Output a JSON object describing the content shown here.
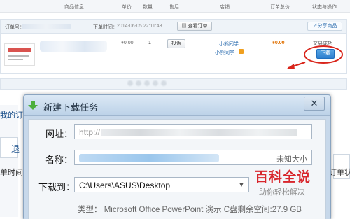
{
  "table_header": {
    "columns": [
      "商品信息",
      "单价",
      "数量",
      "售后",
      "店铺",
      "订单总价",
      "状态与操作"
    ]
  },
  "order": {
    "order_no_label": "订单号：",
    "order_time_label": "下单时间：",
    "order_time": "2014-06-05 22:11:43",
    "view_order_label": "查看订单",
    "share_label": "分享商品",
    "unit_price": "¥0.00",
    "quantity": "1",
    "complaint_label": "投诉",
    "shop_name": "小熊同学",
    "shop_owner": "小熊同学",
    "total_price": "¥0.00",
    "status": "交易成功",
    "download_label": "下载"
  },
  "background": {
    "left_text_1": "我的订",
    "left_text_2": "退",
    "left_text_3": "单时间",
    "right_text": "订单状"
  },
  "dialog": {
    "title": "新建下载任务",
    "close_label": "✕",
    "url_label": "网址：",
    "url_value": "http://",
    "name_label": "名称：",
    "size_unknown": "未知大小",
    "save_to_label": "下载到：",
    "save_to_value": "C:\\Users\\ASUS\\Desktop",
    "info_text": "类型： Microsoft Office PowerPoint 演示 C盘剩余空间:27.9 GB"
  },
  "watermark": {
    "main": "百科全说",
    "sub": "助你轻松解决"
  },
  "colors": {
    "accent_blue": "#2d7fcf",
    "highlight_red": "#d9261c",
    "price_orange": "#e07000"
  }
}
